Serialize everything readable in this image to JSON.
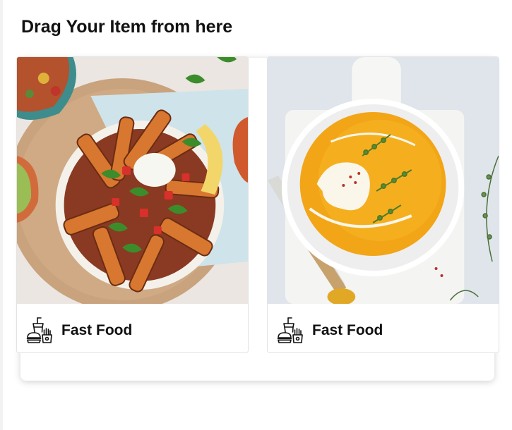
{
  "heading": "Drag Your Item from here",
  "cards": [
    {
      "title": "Fast Food",
      "icon": "fast-food-icon",
      "image": "sweet-potato-bowl-photo"
    },
    {
      "title": "Fast Food",
      "icon": "fast-food-icon",
      "image": "pumpkin-soup-photo"
    }
  ]
}
